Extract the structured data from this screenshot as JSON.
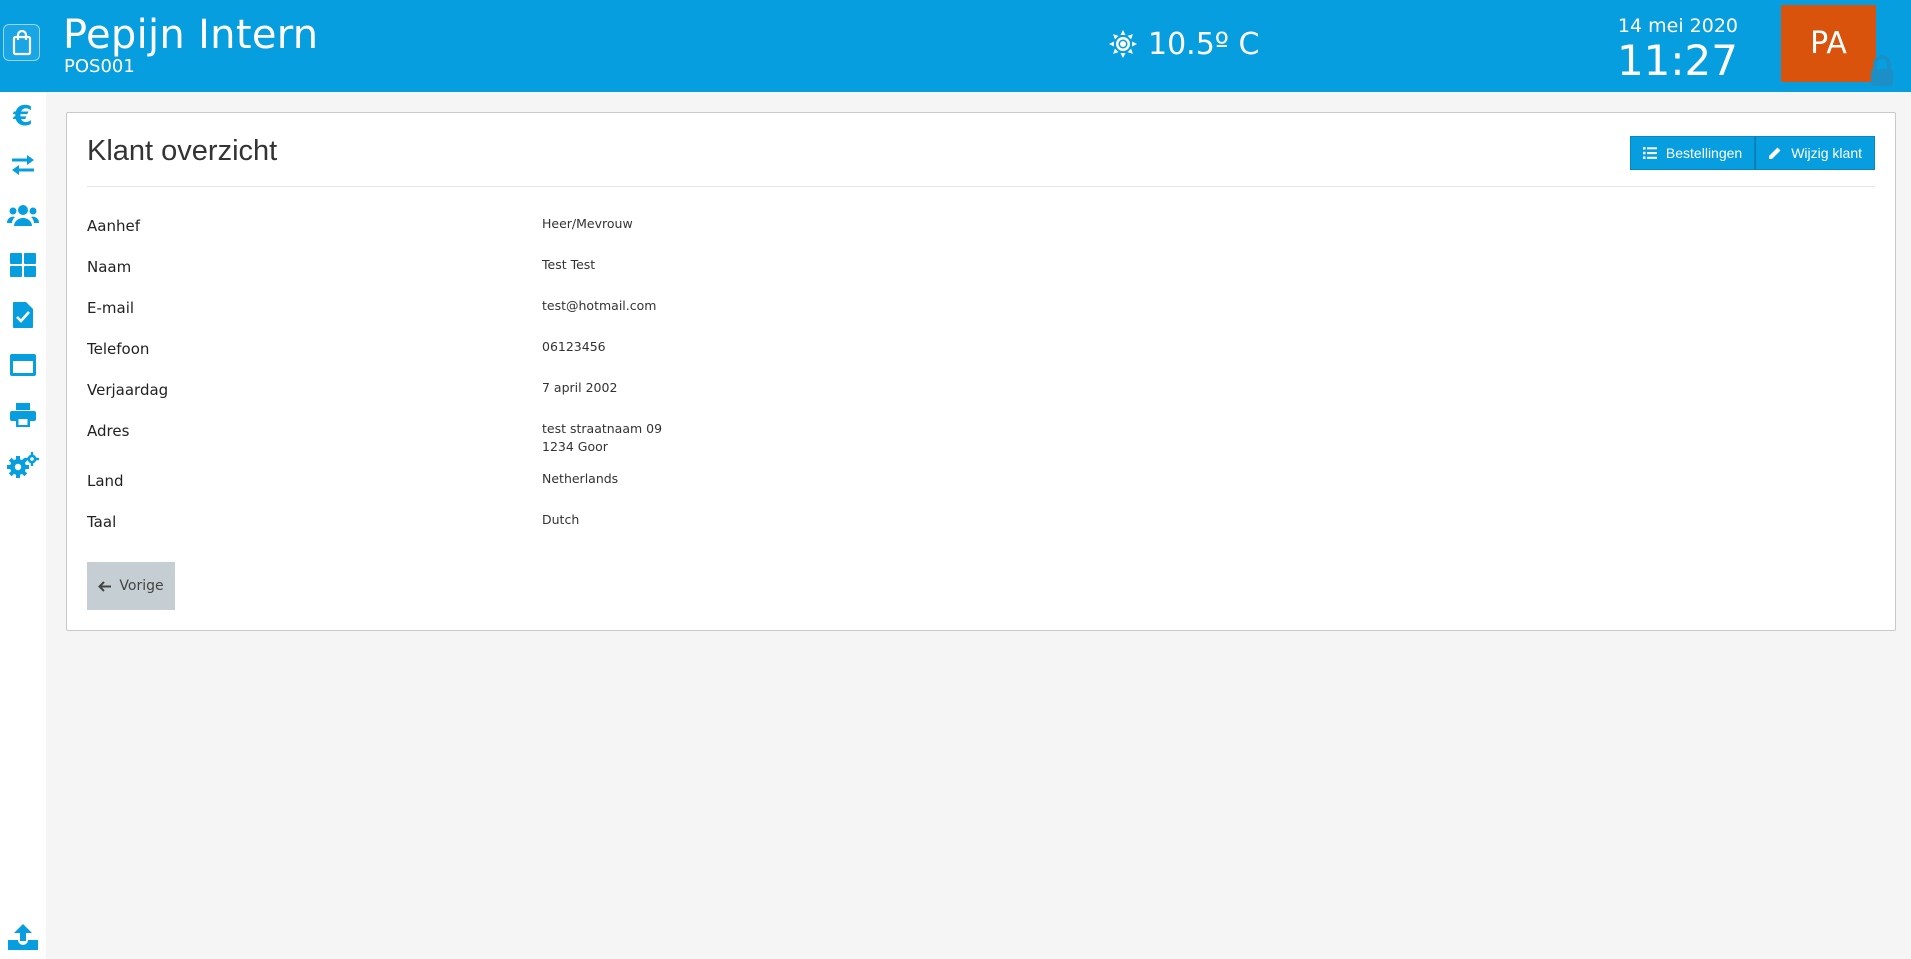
{
  "header": {
    "title": "Pepijn Intern",
    "subtitle": "POS001",
    "temperature": "10.5º C",
    "date": "14 mei 2020",
    "time": "11:27",
    "user_initials": "PA",
    "accent_color": "#079ee0",
    "avatar_color": "#d9530c"
  },
  "sidebar": {
    "items": [
      {
        "icon": "euro-icon"
      },
      {
        "icon": "transfer-arrows-icon"
      },
      {
        "icon": "users-icon"
      },
      {
        "icon": "dashboard-grid-icon"
      },
      {
        "icon": "checked-document-icon"
      },
      {
        "icon": "window-icon"
      },
      {
        "icon": "printer-icon"
      },
      {
        "icon": "settings-cogs-icon"
      },
      {
        "icon": "upload-icon"
      }
    ],
    "euro_symbol": "€"
  },
  "panel": {
    "title": "Klant overzicht",
    "buttons": {
      "orders_label": "Bestellingen",
      "edit_label": "Wijzig klant"
    },
    "fields": [
      {
        "label": "Aanhef",
        "value": "Heer/Mevrouw"
      },
      {
        "label": "Naam",
        "value": "Test Test"
      },
      {
        "label": "E-mail",
        "value": "test@hotmail.com"
      },
      {
        "label": "Telefoon",
        "value": "06123456"
      },
      {
        "label": "Verjaardag",
        "value": "7 april 2002"
      },
      {
        "label": "Adres",
        "value": "test straatnaam 09",
        "value_line2": "1234 Goor"
      },
      {
        "label": "Land",
        "value": "Netherlands"
      },
      {
        "label": "Taal",
        "value": "Dutch"
      }
    ],
    "back_label": "Vorige"
  }
}
